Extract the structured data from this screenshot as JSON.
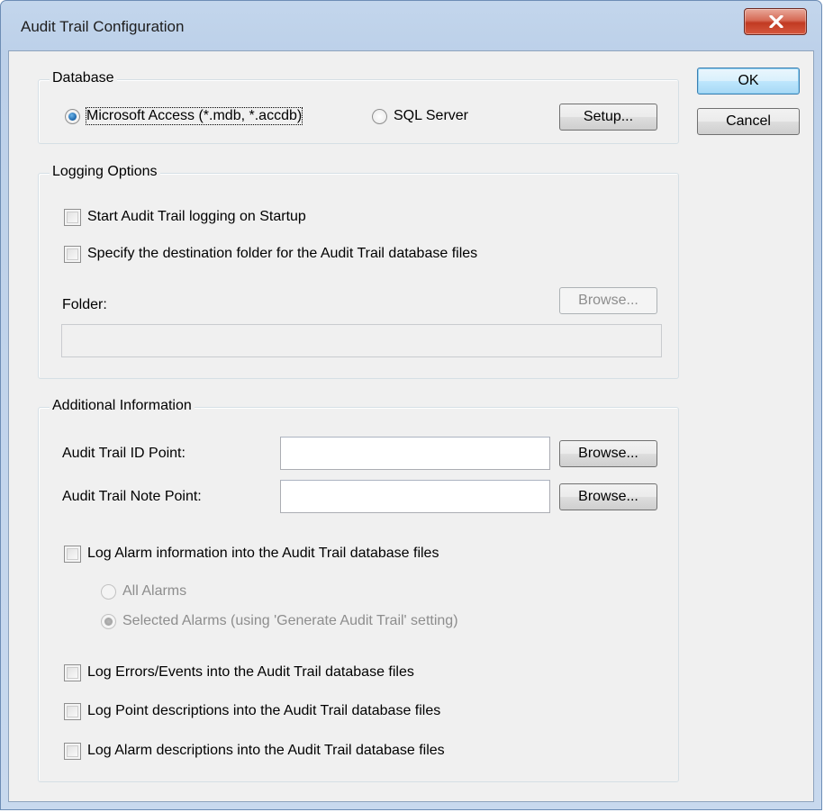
{
  "window": {
    "title": "Audit Trail Configuration"
  },
  "buttons": {
    "ok": "OK",
    "cancel": "Cancel"
  },
  "database": {
    "group_title": "Database",
    "options": [
      {
        "label": "Microsoft Access (*.mdb, *.accdb)",
        "selected": true
      },
      {
        "label": "SQL Server",
        "selected": false
      }
    ],
    "setup_label": "Setup..."
  },
  "logging": {
    "group_title": "Logging Options",
    "start_on_startup": {
      "label": "Start Audit Trail logging on Startup",
      "checked": false
    },
    "specify_folder": {
      "label": "Specify the destination folder for the Audit Trail database files",
      "checked": false
    },
    "folder_label": "Folder:",
    "browse_label": "Browse...",
    "folder_value": ""
  },
  "additional": {
    "group_title": "Additional Information",
    "id_point": {
      "label": "Audit Trail ID Point:",
      "value": "",
      "browse_label": "Browse..."
    },
    "note_point": {
      "label": "Audit Trail Note Point:",
      "value": "",
      "browse_label": "Browse..."
    },
    "log_alarm_info": {
      "label": "Log Alarm information into the Audit Trail database files",
      "checked": false
    },
    "alarm_options": [
      {
        "label": "All Alarms",
        "selected": false,
        "enabled": false
      },
      {
        "label": "Selected Alarms (using 'Generate Audit Trail' setting)",
        "selected": true,
        "enabled": false
      }
    ],
    "log_errors": {
      "label": "Log Errors/Events into the Audit Trail database files",
      "checked": false
    },
    "log_point_desc": {
      "label": "Log Point descriptions into the Audit Trail database files",
      "checked": false
    },
    "log_alarm_desc": {
      "label": "Log Alarm descriptions into the Audit Trail database files",
      "checked": false
    }
  },
  "colors": {
    "title_bar": "#bcd0e9",
    "close_button": "#c13a22",
    "dialog_bg": "#f0f0f0",
    "default_button_border": "#3c7fb1"
  },
  "icons": {
    "close": "close-icon"
  }
}
